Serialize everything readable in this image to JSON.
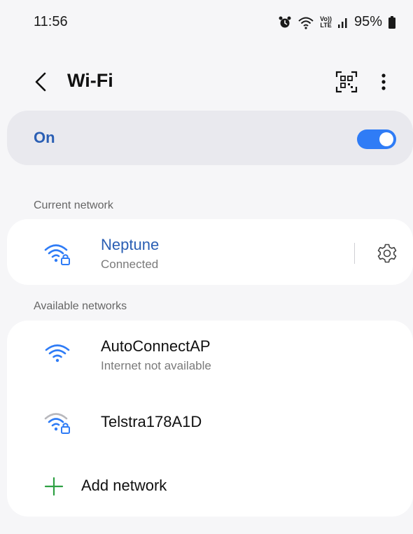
{
  "status": {
    "time": "11:56",
    "battery": "95%",
    "lte_top": "Vo))",
    "lte_bottom": "LTE",
    "icons": [
      "alarm-icon",
      "wifi-status-icon",
      "volte-icon",
      "signal-icon",
      "battery-icon"
    ]
  },
  "header": {
    "title": "Wi-Fi",
    "back_icon": "chevron-left-icon",
    "qr_icon": "qr-scan-icon",
    "more_icon": "more-vert-icon"
  },
  "wifi_toggle": {
    "label": "On",
    "state": true,
    "accent": "#2f7cf6"
  },
  "current_network": {
    "section_label": "Current network",
    "name": "Neptune",
    "status": "Connected",
    "secured": true,
    "name_color": "#2b5fb4",
    "settings_icon": "gear-icon"
  },
  "available_networks": {
    "section_label": "Available networks",
    "items": [
      {
        "name": "AutoConnectAP",
        "subtitle": "Internet not available",
        "secured": false
      },
      {
        "name": "Telstra178A1D",
        "subtitle": "",
        "secured": true
      }
    ],
    "add_label": "Add network",
    "add_color": "#2ea043"
  }
}
